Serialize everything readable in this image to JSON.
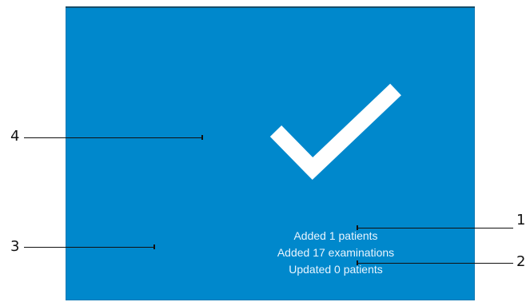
{
  "dialog": {
    "icon": "checkmark-icon",
    "background_color": "#0088cc",
    "icon_color": "#ffffff",
    "messages": [
      "Added 1 patients",
      "Added 17 examinations",
      "Updated 0 patients"
    ]
  },
  "callouts": {
    "one": "1",
    "two": "2",
    "three": "3",
    "four": "4"
  }
}
